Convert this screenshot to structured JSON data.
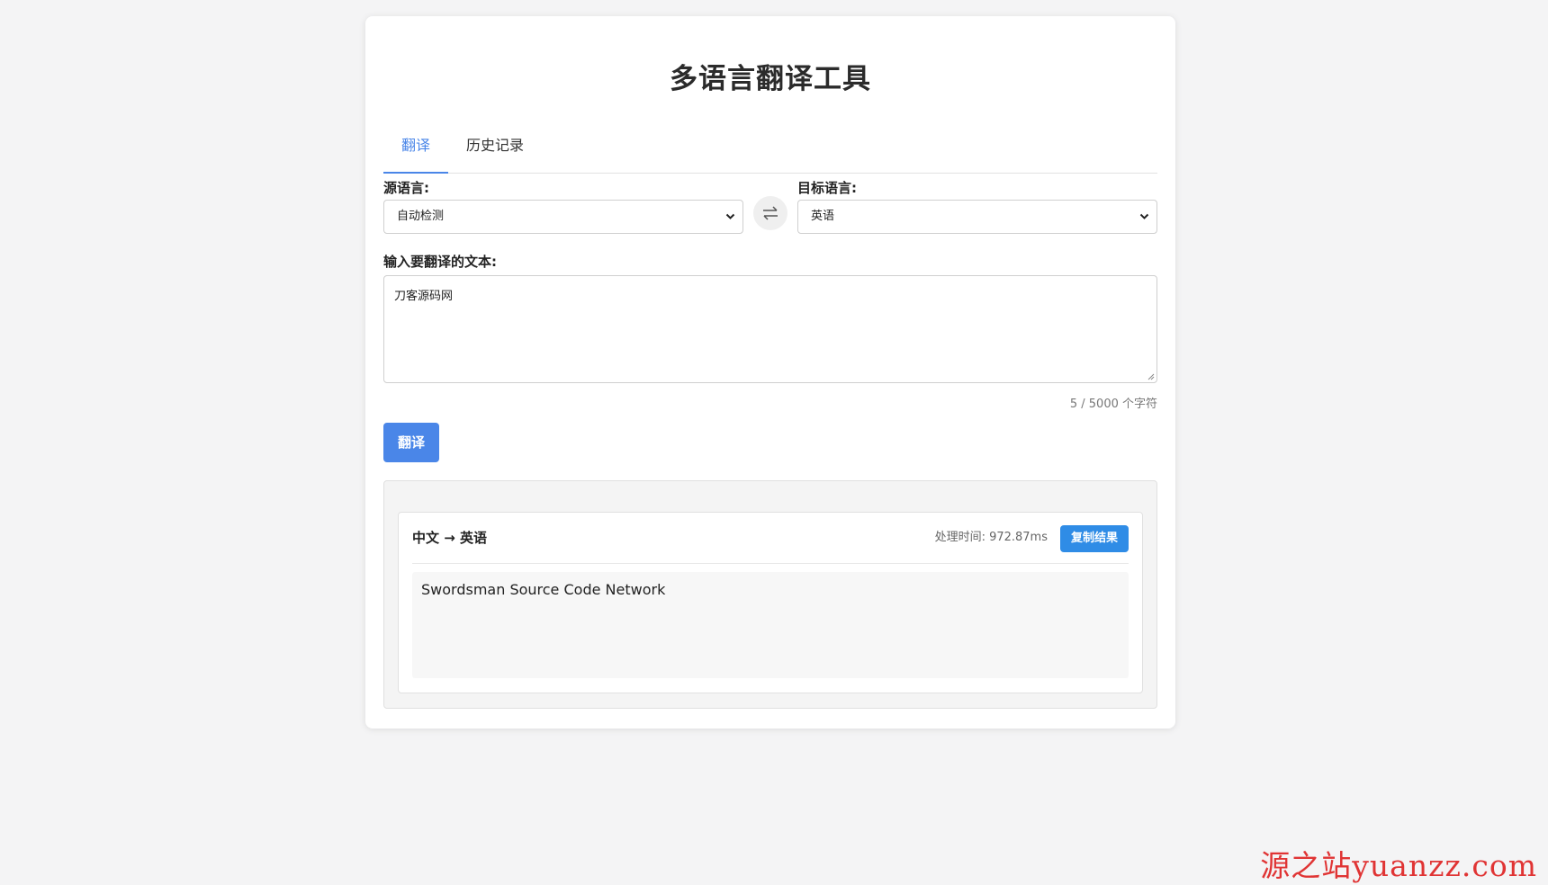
{
  "title": "多语言翻译工具",
  "tabs": [
    {
      "label": "翻译",
      "active": true
    },
    {
      "label": "历史记录",
      "active": false
    }
  ],
  "source": {
    "label": "源语言:",
    "selected": "自动检测"
  },
  "target": {
    "label": "目标语言:",
    "selected": "英语"
  },
  "swap": {
    "icon": "swap-arrows-icon"
  },
  "input": {
    "label": "输入要翻译的文本:",
    "value": "刀客源码网",
    "counter": "5 / 5000 个字符"
  },
  "translate_button": "翻译",
  "result": {
    "lang_pair": "中文 → 英语",
    "processing_time": "处理时间: 972.87ms",
    "copy_button": "复制结果",
    "text": "Swordsman Source Code Network"
  },
  "watermark": "源之站yuanzz.com",
  "colors": {
    "accent": "#4a86e8",
    "copy_button": "#2f8ce6",
    "watermark": "#e03434"
  }
}
